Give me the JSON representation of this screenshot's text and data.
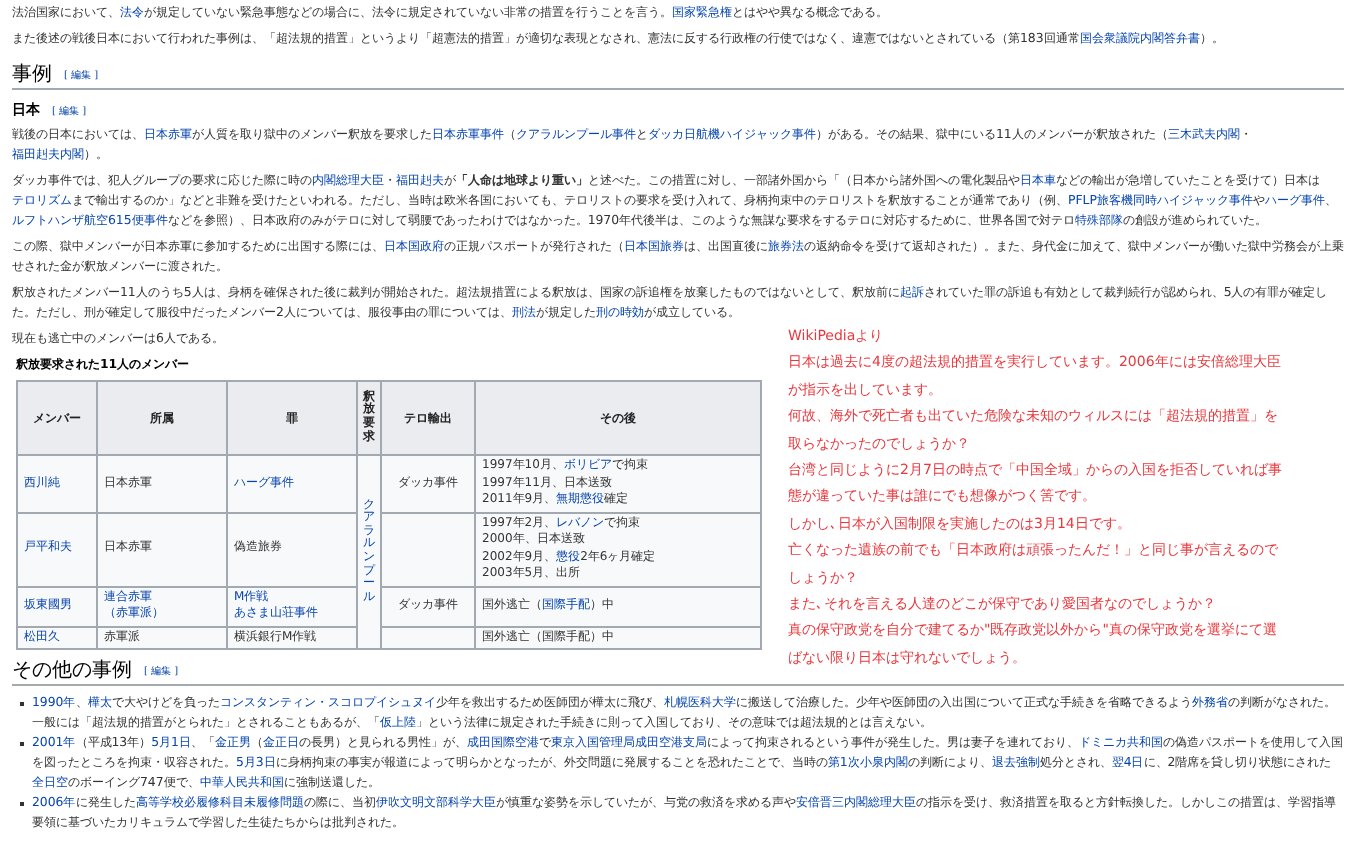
{
  "intro": [
    [
      "法治国家において、",
      {
        "link": "法令"
      },
      "が規定していない緊急事態などの場合に、法令に規定されていない非常の措置を行うことを言う。",
      {
        "link": "国家緊急権"
      },
      "とはやや異なる概念である。"
    ],
    [
      "また後述の戦後日本において行われた事例は、「超法規的措置」というより「超憲法的措置」が適切な表現となされ、憲法に反する行政権の行使ではなく、違憲ではないとされている（第183回通常",
      {
        "link": "国会衆議院内閣答弁書"
      },
      "）。"
    ]
  ],
  "section": {
    "heading": "事例",
    "edit_link": "[ 編集 ]",
    "subheading": "日本",
    "sub_edit_link": "[ 編集 ]",
    "paragraphs": [
      [
        "戦後の日本においては、",
        {
          "link": "日本赤軍"
        },
        "が人質を取り獄中のメンバー釈放を要求した",
        {
          "link": "日本赤軍事件"
        },
        "（",
        {
          "link": "クアラルンプール事件"
        },
        "と",
        {
          "link": "ダッカ日航機ハイジャック事件"
        },
        "）がある。その結果、獄中にいる11人のメンバーが釈放された（",
        {
          "link": "三木武夫内閣"
        },
        "・",
        {
          "link": "福田赳夫内閣"
        },
        "）。"
      ],
      [
        "ダッカ事件では、犯人グループの要求に応じた際に時の",
        {
          "link": "内閣総理大臣"
        },
        "・",
        {
          "link": "福田赳夫"
        },
        "が**「人命は地球より重い」**と述べた。この措置に対し、一部諸外国から「（日本から諸外国への電化製品や",
        {
          "link": "日本車"
        },
        "などの輸出が急増していたことを受けて）日本は",
        {
          "link": "テロリズム"
        },
        "まで輸出するのか」などと非難を受けたといわれる。ただし、当時は欧米各国においても、テロリストの要求を受け入れて、身柄拘束中のテロリストを釈放することが通常であり（例、",
        {
          "link": "PFLP旅客機同時ハイジャック事件"
        },
        "や",
        {
          "link": "ハーグ事件"
        },
        "、",
        {
          "link": "ルフトハンザ航空615便事件"
        },
        "などを参照）、日本政府のみがテロに対して弱腰であったわけではなかった。1970年代後半は、このような無謀な要求をするテロに対応するために、世界各国で対テロ",
        {
          "link": "特殊部隊"
        },
        "の創設が進められていた。"
      ],
      [
        "この際、獄中メンバーが日本赤軍に参加するために出国する際には、",
        {
          "link": "日本国政府"
        },
        "の正規パスポートが発行された（",
        {
          "link": "日本国旅券"
        },
        "は、出国直後に",
        {
          "link": "旅券法"
        },
        "の返納命令を受けて返却された）。また、身代金に加えて、獄中メンバーが働いた獄中労務会が上乗せされた金が釈放メンバーに渡された。"
      ],
      [
        "釈放されたメンバー11人のうち5人は、身柄を確保された後に裁判が開始された。超法規措置による釈放は、国家の訴追権を放棄したものではないとして、釈放前に",
        {
          "link": "起訴"
        },
        "されていた罪の訴追も有効として裁判続行が認められ、5人の有罪が確定した。ただし、刑が確定して服役中だったメンバー2人については、服役事由の罪については、",
        {
          "link": "刑法"
        },
        "が規定した",
        {
          "link": "刑の時効"
        },
        "が成立している。"
      ],
      [
        "現在も逃亡中のメンバーは6人である。"
      ]
    ],
    "table": {
      "caption": "釈放要求された11人のメンバー",
      "columns": [
        {
          "label": "メンバー",
          "kind": "normal"
        },
        {
          "label": "所属",
          "kind": "normal"
        },
        {
          "label": "罪",
          "kind": "normal"
        },
        {
          "label": "釈放要求",
          "kind": "vertical"
        },
        {
          "label": "テロ輸出",
          "kind": "normal"
        },
        {
          "label": "その後",
          "kind": "normal"
        }
      ],
      "rows": [
        {
          "cells": [
            [
              [
                {
                  "link": "西川純"
                }
              ]
            ],
            [
              [
                "日本赤軍"
              ]
            ],
            [
              [
                {
                  "link": "ハーグ事件"
                }
              ]
            ],
            {
              "text": "クアラルンプール",
              "rowspan": 4
            },
            [
              [
                "ダッカ事件"
              ]
            ],
            [
              [
                "1997年10月、",
                {
                  "link": "ボリビア"
                },
                "で拘束"
              ],
              [
                "1997年11月、日本送致"
              ],
              [
                "2011年9月、",
                {
                  "link": "無期懲役"
                },
                "確定"
              ]
            ]
          ]
        },
        {
          "cells": [
            [
              [
                {
                  "link": "戸平和夫"
                }
              ]
            ],
            [
              [
                "日本赤軍"
              ]
            ],
            [
              [
                "偽造旅券"
              ]
            ],
            [],
            [
              [
                "1997年2月、",
                {
                  "link": "レバノン"
                },
                "で拘束"
              ],
              [
                "2000年、日本送致"
              ],
              [
                "2002年9月、",
                {
                  "link": "懲役"
                },
                "2年6ヶ月確定"
              ],
              [
                "2003年5月、出所"
              ]
            ]
          ]
        },
        {
          "cells": [
            [
              [
                {
                  "link": "坂東國男"
                }
              ]
            ],
            [
              [
                {
                  "link": "連合赤軍"
                }
              ],
              [
                {
                  "link": "（赤軍派）"
                }
              ]
            ],
            [
              [
                {
                  "link": "M作戦"
                }
              ],
              [
                {
                  "link": "あさま山荘事件"
                }
              ]
            ],
            [
              [
                "ダッカ事件"
              ]
            ],
            [
              [
                "国外逃亡（",
                {
                  "link": "国際手配"
                },
                "）中"
              ]
            ]
          ]
        },
        {
          "cells": [
            [
              [
                {
                  "link": "松田久"
                }
              ]
            ],
            [
              [
                "赤軍派"
              ]
            ],
            [
              [
                "横浜銀行M作戦"
              ]
            ],
            [],
            [
              [
                "国外逃亡（国際手配）中"
              ]
            ]
          ]
        }
      ]
    }
  },
  "annotation": {
    "lines": [
      "WikiPediaより",
      "日本は過去に4度の超法規的措置を実行しています。2006年には安倍総理大臣",
      "が指示を出しています。",
      "何故、海外で死亡者も出ていた危険な未知のウィルスには「超法規的措置」を",
      "取らなかったのでしょうか？",
      "台湾と同じように2月7日の時点で「中国全域」からの入国を拒否していれば事",
      "態が違っていた事は誰にでも想像がつく筈です。",
      "しかし､日本が入国制限を実施したのは3月14日です。",
      "亡くなった遺族の前でも「日本政府は頑張ったんだ！」と同じ事が言えるので",
      "しょうか？",
      "また､それを言える人達のどこが保守であり愛国者なのでしょうか？",
      "真の保守政党を自分で建てるか\"既存政党以外から\"真の保守政党を選挙にて選",
      "ばない限り日本は守れないでしょう。"
    ]
  },
  "other": {
    "heading": "その他の事例",
    "edit_link": "[ 編集 ]",
    "items": [
      [
        {
          "link": "1990年"
        },
        "、",
        {
          "link": "樺太"
        },
        "で大やけどを負った",
        {
          "link": "コンスタンティン・スコロプイシュヌイ"
        },
        "少年を救出するため医師団が樺太に飛び、",
        {
          "link": "札幌医科大学"
        },
        "に搬送して治療した。少年や医師団の入出国について正式な手続きを省略できるよう",
        {
          "link": "外務省"
        },
        "の判断がなされた。一般には「超法規的措置がとられた」とされることもあるが、「",
        {
          "link": "仮上陸"
        },
        "」という法律に規定された手続きに則って入国しており、その意味では超法規的とは言えない。"
      ],
      [
        {
          "link": "2001年"
        },
        "（平成13年）",
        {
          "link": "5月1日"
        },
        "、「",
        {
          "link": "金正男"
        },
        "（",
        {
          "link": "金正日"
        },
        "の長男）と見られる男性」が、",
        {
          "link": "成田国際空港"
        },
        "で",
        {
          "link": "東京入国管理局成田空港支局"
        },
        "によって拘束されるという事件が発生した。男は妻子を連れており、",
        {
          "link": "ドミニカ共和国"
        },
        "の偽造パスポートを使用して入国を図ったところを拘束・収容された。",
        {
          "link": "5月3日"
        },
        "に身柄拘束の事実が報道によって明らかとなったが、外交問題に発展することを恐れたことで、当時の",
        {
          "link": "第1次小泉内閣"
        },
        "の判断により、",
        {
          "link": "退去強制"
        },
        "処分とされ、",
        {
          "link": "翌4日"
        },
        "に、2階席を貸し切り状態にされた",
        {
          "link": "全日空"
        },
        "のボーイング747便で、",
        {
          "link": "中華人民共和国"
        },
        "に強制送還した。"
      ],
      [
        {
          "link": "2006年"
        },
        "に発生した",
        {
          "link": "高等学校必履修科目未履修問題"
        },
        "の際に、当初",
        {
          "link": "伊吹文明文部科学大臣"
        },
        "が慎重な姿勢を示していたが、与党の救済を求める声や",
        {
          "link": "安倍晋三内閣総理大臣"
        },
        "の指示を受け、救済措置を取ると方針転換した。しかしこの措置は、学習指導要領に基づいたカリキュラムで学習した生徒たちからは批判された。"
      ]
    ]
  }
}
